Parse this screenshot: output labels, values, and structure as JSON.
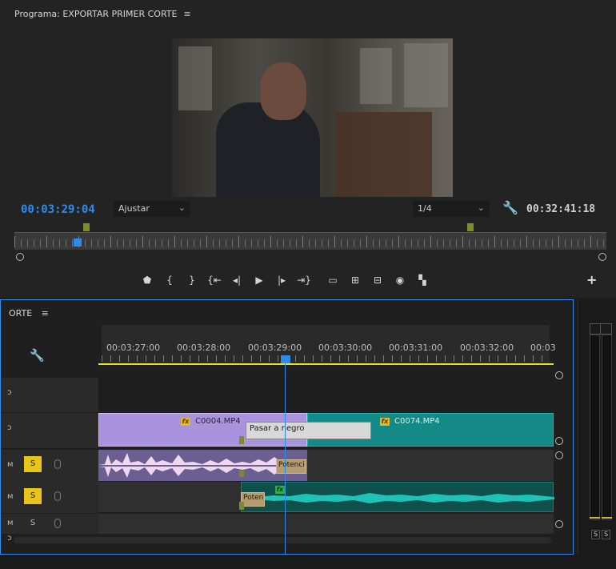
{
  "program": {
    "title": "Programa: EXPORTAR PRIMER CORTE",
    "menu_icon": "≡",
    "current_timecode": "00:03:29:04",
    "fit_label": "Ajustar",
    "resolution_label": "1/4",
    "duration_timecode": "00:32:41:18",
    "transport": [
      "marker",
      "mark-in",
      "mark-out",
      "go-to-in",
      "step-back",
      "play",
      "step-forward",
      "go-to-out",
      "lift",
      "extract",
      "overwrite",
      "export-frame",
      "compare"
    ],
    "add_label": "+"
  },
  "timeline": {
    "tab_label": "ORTE",
    "menu_icon": "≡",
    "ruler_labels": [
      "00:03:27:00",
      "00:03:28:00",
      "00:03:29:00",
      "00:03:30:00",
      "00:03:31:00",
      "00:03:32:00",
      "00:03"
    ],
    "video_clip_1": "C0004.MP4",
    "video_clip_2": "C0074.MP4",
    "transition_video": "Pasar a negro",
    "transition_audio_1": "Potenci",
    "transition_audio_2": "Poten",
    "fx_label": "fx",
    "solo_label": "S",
    "track_letters": {
      "v2": "ɔ",
      "v1": "ɔ",
      "a1": "ᴍ",
      "a2": "ᴍ",
      "a3": "ᴍ",
      "bottom": "ɔ"
    }
  },
  "meters": {
    "solo_left": "S",
    "solo_right": "S"
  },
  "colors": {
    "accent_blue": "#2d8ceb",
    "clip_violet": "#a893dc",
    "clip_teal": "#138a85",
    "solo_yellow": "#e8c619",
    "marker_green": "#7d8a2e",
    "work_area_yellow": "#e8e12a"
  }
}
